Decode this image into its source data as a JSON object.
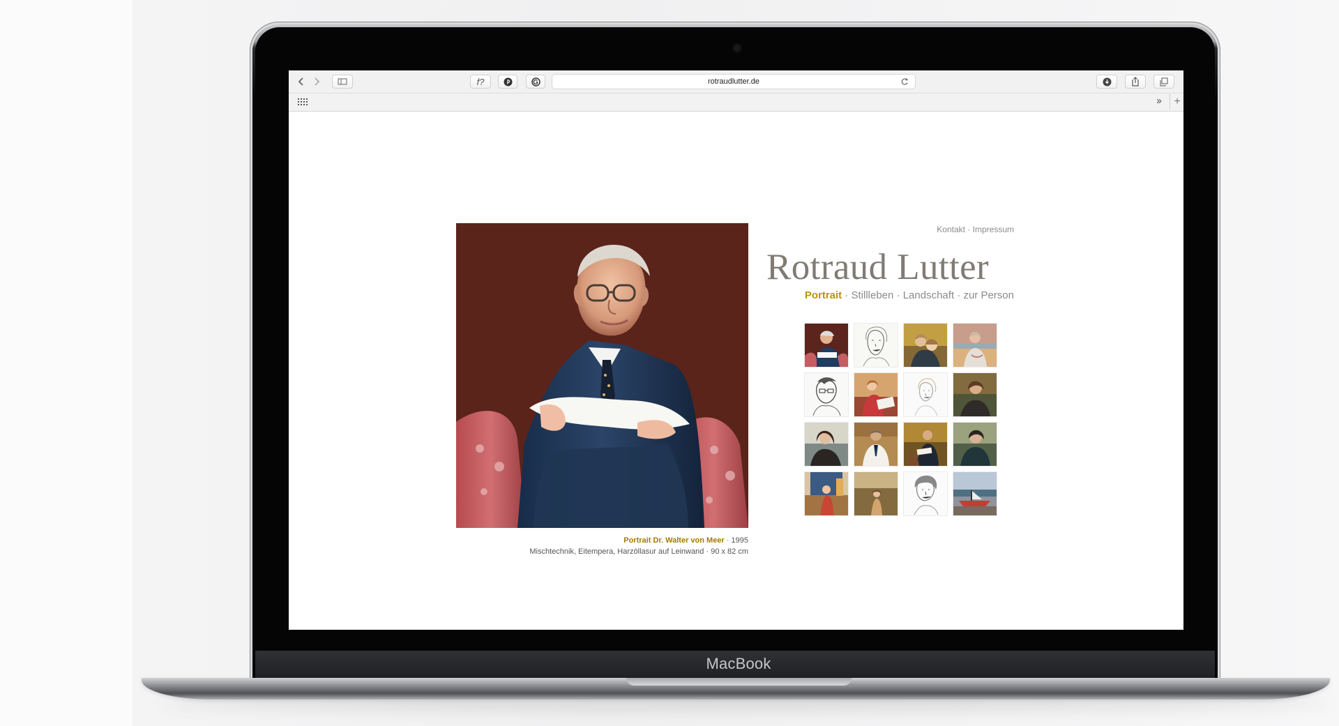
{
  "browser": {
    "url": "rotraudlutter.de",
    "toolbar": {
      "font_label": "f?",
      "overflow_label": "››",
      "new_tab_label": "+"
    }
  },
  "page": {
    "top_links": {
      "contact": "Kontakt",
      "separator": "·",
      "imprint": "Impressum"
    },
    "artist_name": "Rotraud Lutter",
    "categories": [
      {
        "label": "Portrait",
        "active": true
      },
      {
        "label": "Stillleben",
        "active": false
      },
      {
        "label": "Landschaft",
        "active": false
      },
      {
        "label": "zur Person",
        "active": false
      }
    ],
    "category_separator": "·",
    "featured_work": {
      "title": "Portrait Dr. Walter von Meer",
      "separator": "·",
      "year": "1995",
      "details": "Mischtechnik, Eitempera, Harzöllasur auf Leinwand · 90 x 82 cm"
    },
    "thumbnails": [
      {
        "name": "seated-man-portrait"
      },
      {
        "name": "woman-sketch-portrait"
      },
      {
        "name": "two-children-portrait"
      },
      {
        "name": "woman-by-sea-portrait"
      },
      {
        "name": "man-with-glasses-sketch"
      },
      {
        "name": "woman-red-dress-portrait"
      },
      {
        "name": "light-woman-sketch"
      },
      {
        "name": "woman-in-field-portrait"
      },
      {
        "name": "woman-dark-hair-portrait"
      },
      {
        "name": "doctor-white-coat-portrait"
      },
      {
        "name": "man-in-chair-portrait"
      },
      {
        "name": "young-man-portrait"
      },
      {
        "name": "girl-interior-portrait"
      },
      {
        "name": "child-meadow-portrait"
      },
      {
        "name": "older-woman-sketch"
      },
      {
        "name": "boat-harbor-painting"
      }
    ]
  },
  "device": {
    "brand": "MacBook"
  },
  "colors": {
    "active_category": "#bd9400",
    "caption_title": "#a37b00",
    "artist_name": "#817b73",
    "secondary_text": "#8b8b8b"
  }
}
